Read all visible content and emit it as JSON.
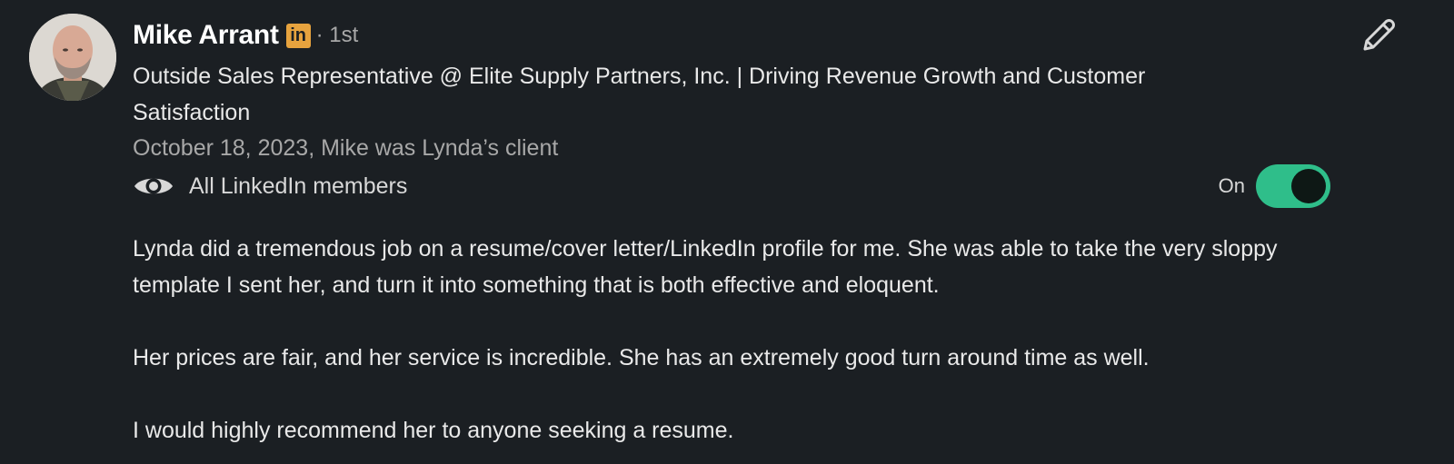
{
  "recommendation": {
    "author": {
      "name": "Mike Arrant",
      "badge_text": "in",
      "degree": "· 1st",
      "headline": "Outside Sales Representative @ Elite Supply Partners, Inc. | Driving Revenue Growth and Customer Satisfaction"
    },
    "date_relationship": "October 18, 2023, Mike was Lynda’s client",
    "visibility": {
      "icon": "eye-icon",
      "label": "All LinkedIn members",
      "toggle_label": "On",
      "toggle_state": "on"
    },
    "body": [
      "Lynda did a tremendous job on a resume/cover letter/LinkedIn profile for me. She was able to take the very sloppy template I sent her, and turn it into something that is both effective and eloquent.",
      "Her prices are fair, and her service is incredible. She has an extremely good turn around time as well.",
      "I would highly recommend her to anyone seeking a resume."
    ]
  },
  "colors": {
    "background": "#1b1f23",
    "toggle_on": "#2fbe8a",
    "badge": "#e7a33e"
  }
}
